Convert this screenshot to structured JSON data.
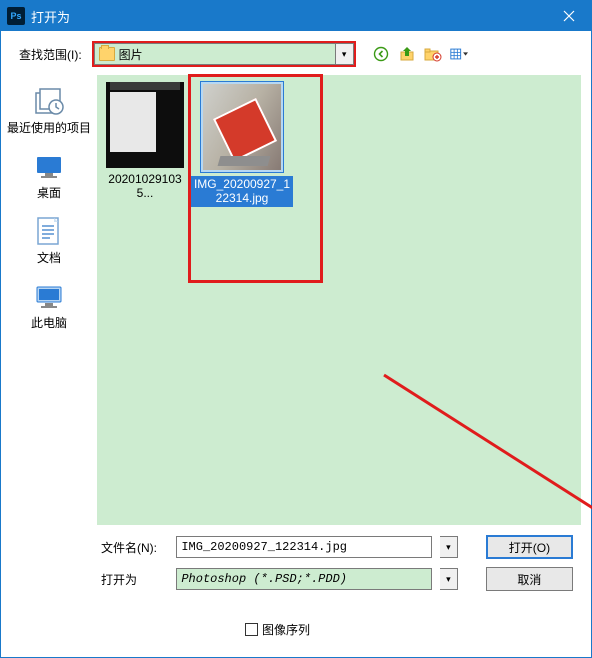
{
  "titlebar": {
    "app_code": "Ps",
    "title": "打开为"
  },
  "toolbar": {
    "lookin_label": "查找范围(I):",
    "folder_name": "图片"
  },
  "sidebar": {
    "items": [
      {
        "label": "最近使用的项目"
      },
      {
        "label": "桌面"
      },
      {
        "label": "文档"
      },
      {
        "label": "此电脑"
      }
    ]
  },
  "files": [
    {
      "name": "202010291035..."
    },
    {
      "name": "IMG_20200927_122314.jpg"
    }
  ],
  "form": {
    "filename_label": "文件名(N):",
    "filename_value": "IMG_20200927_122314.jpg",
    "openas_label": "打开为",
    "openas_value": "Photoshop (*.PSD;*.PDD)",
    "open_btn": "打开(O)",
    "cancel_btn": "取消"
  },
  "checkbox": {
    "label": "图像序列"
  }
}
